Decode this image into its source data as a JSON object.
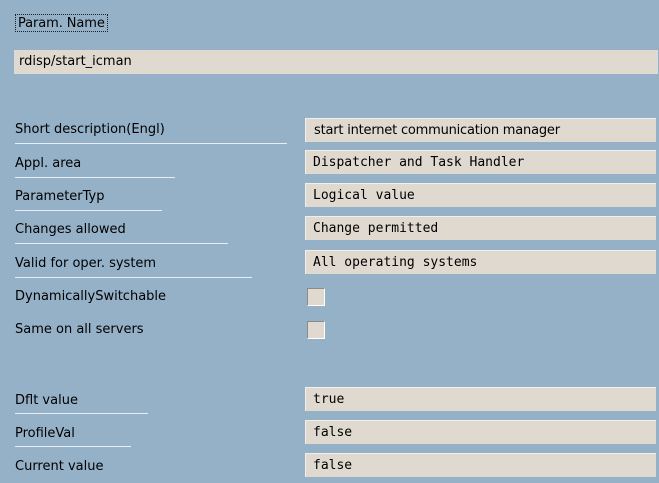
{
  "header": {
    "section_label": "Param. Name",
    "param_name_value": "rdisp/start_icman"
  },
  "attributes": [
    {
      "label": "Short description(Engl)",
      "value": "start internet communication manager",
      "kind": "text"
    },
    {
      "label": "Appl. area",
      "value": "Dispatcher and Task Handler",
      "kind": "mono"
    },
    {
      "label": "ParameterTyp",
      "value": "Logical value",
      "kind": "mono"
    },
    {
      "label": "Changes allowed",
      "value": "Change permitted",
      "kind": "mono"
    },
    {
      "label": "Valid for oper. system",
      "value": "All operating systems",
      "kind": "mono"
    },
    {
      "label": "DynamicallySwitchable",
      "checked": false,
      "kind": "checkbox"
    },
    {
      "label": "Same on all servers",
      "checked": false,
      "kind": "checkbox"
    }
  ],
  "values": [
    {
      "label": "Dflt value",
      "value": "true"
    },
    {
      "label": "ProfileVal",
      "value": "false"
    },
    {
      "label": "Current value",
      "value": "false"
    }
  ],
  "colors": {
    "background": "#95b1c8",
    "field": "#dfd9cf",
    "underline": "#e8eef3"
  }
}
